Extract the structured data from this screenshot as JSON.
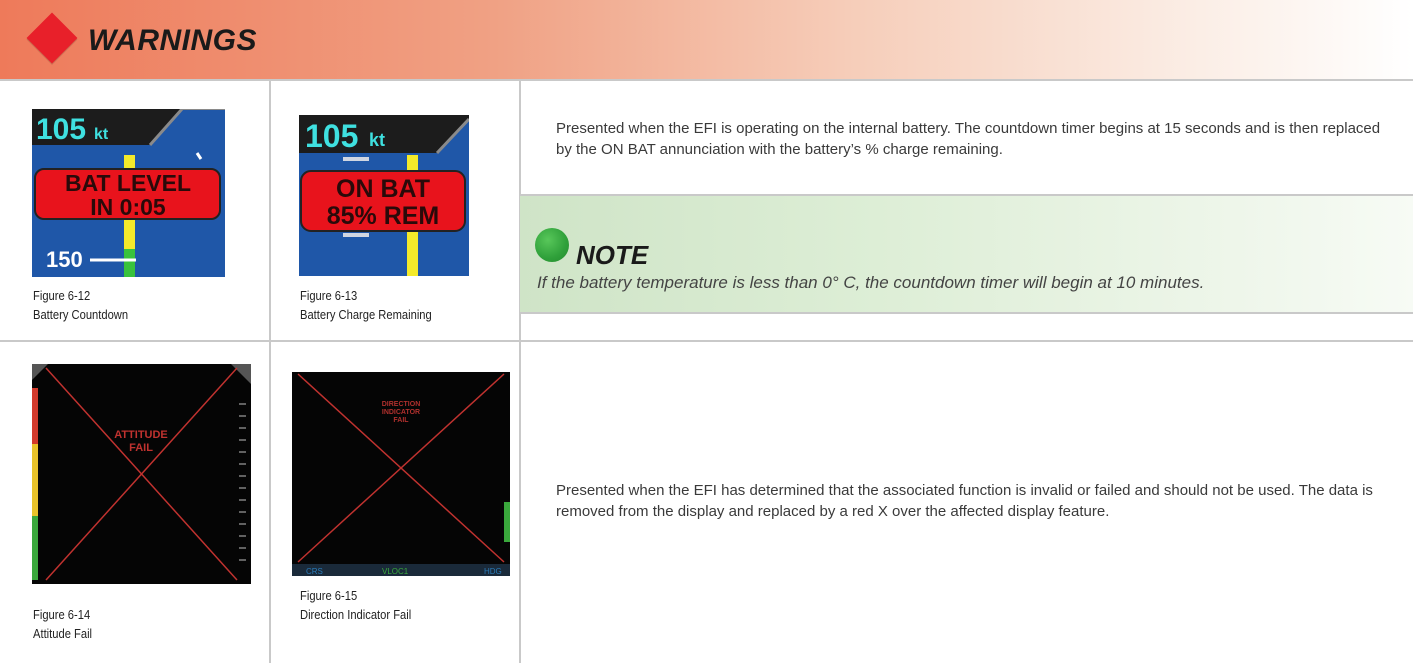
{
  "header": {
    "title": "WARNINGS"
  },
  "figures": [
    {
      "number": "Figure 6-12",
      "title": "Battery Countdown",
      "speed": "105",
      "unit": "kt",
      "alert_line1": "BAT LEVEL",
      "alert_line2": "IN 0:05",
      "tick_label": "150"
    },
    {
      "number": "Figure 6-13",
      "title": "Battery Charge Remaining",
      "speed": "105",
      "unit": "kt",
      "alert_line1": "ON BAT",
      "alert_line2": "85% REM"
    },
    {
      "number": "Figure 6-14",
      "title": "Attitude Fail",
      "fail_line1": "ATTITUDE",
      "fail_line2": "FAIL"
    },
    {
      "number": "Figure 6-15",
      "title": "Direction Indicator Fail",
      "fail_line1": "DIRECTION",
      "fail_line2": "INDICATOR",
      "fail_line3": "FAIL",
      "bottom_labels": [
        "CRS",
        "VLOC1",
        "HDG"
      ]
    }
  ],
  "descriptions": {
    "battery": "Presented when the EFI is operating on the internal battery. The countdown timer begins at 15 seconds and is then replaced by the ON BAT annunciation with the battery’s % charge remaining.",
    "fail": "Presented when the EFI has determined that the associated function is invalid or failed and should not be used. The data is removed from the display and replaced by a red X over the affected display feature."
  },
  "note": {
    "title": "NOTE",
    "text": "If the battery temperature is less than 0° C, the countdown timer will begin at 10 minutes."
  },
  "colors": {
    "warning_red": "#e8202a",
    "note_green": "#2fa03a",
    "display_blue": "#1f57a8",
    "fail_red": "#c0322f"
  }
}
